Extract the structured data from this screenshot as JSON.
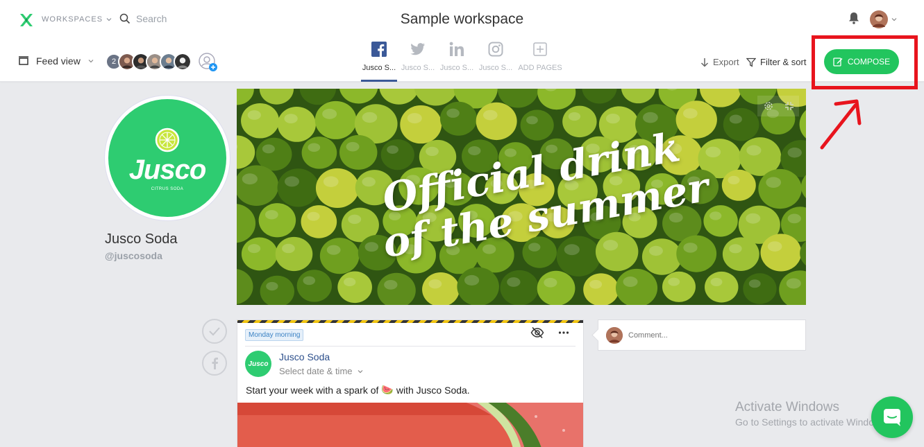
{
  "header": {
    "workspaces_label": "WORKSPACES",
    "search_placeholder": "Search",
    "title": "Sample workspace"
  },
  "toolbar": {
    "feed_view_label": "Feed view",
    "member_count": "2",
    "export_label": "Export",
    "filter_label": "Filter & sort",
    "compose_label": "COMPOSE"
  },
  "pages": [
    {
      "label": "Jusco S...",
      "icon": "facebook-icon",
      "active": true
    },
    {
      "label": "Jusco S...",
      "icon": "twitter-icon",
      "active": false
    },
    {
      "label": "Jusco S...",
      "icon": "linkedin-icon",
      "active": false
    },
    {
      "label": "Jusco S...",
      "icon": "instagram-icon",
      "active": false
    },
    {
      "label": "ADD PAGES",
      "icon": "add-page-icon",
      "active": false
    }
  ],
  "profile": {
    "logo_word": "Jusco",
    "logo_sub": "CITRUS SODA",
    "name": "Jusco Soda",
    "handle": "@juscosoda"
  },
  "cover": {
    "line1": "Official drink",
    "line2": "of the summer"
  },
  "post": {
    "tag": "Monday morning",
    "author": "Jusco Soda",
    "avatar_text": "Jusco",
    "date_placeholder": "Select date & time",
    "text_before": "Start your week with a spark of",
    "emoji": "🍉",
    "text_after": "with Jusco Soda."
  },
  "comment": {
    "placeholder": "Comment..."
  },
  "watermark": {
    "title": "Activate Windows",
    "subtitle": "Go to Settings to activate Windows."
  },
  "colors": {
    "accent_green": "#22c55e",
    "facebook_blue": "#3b5998",
    "highlight_red": "#e8141d"
  }
}
